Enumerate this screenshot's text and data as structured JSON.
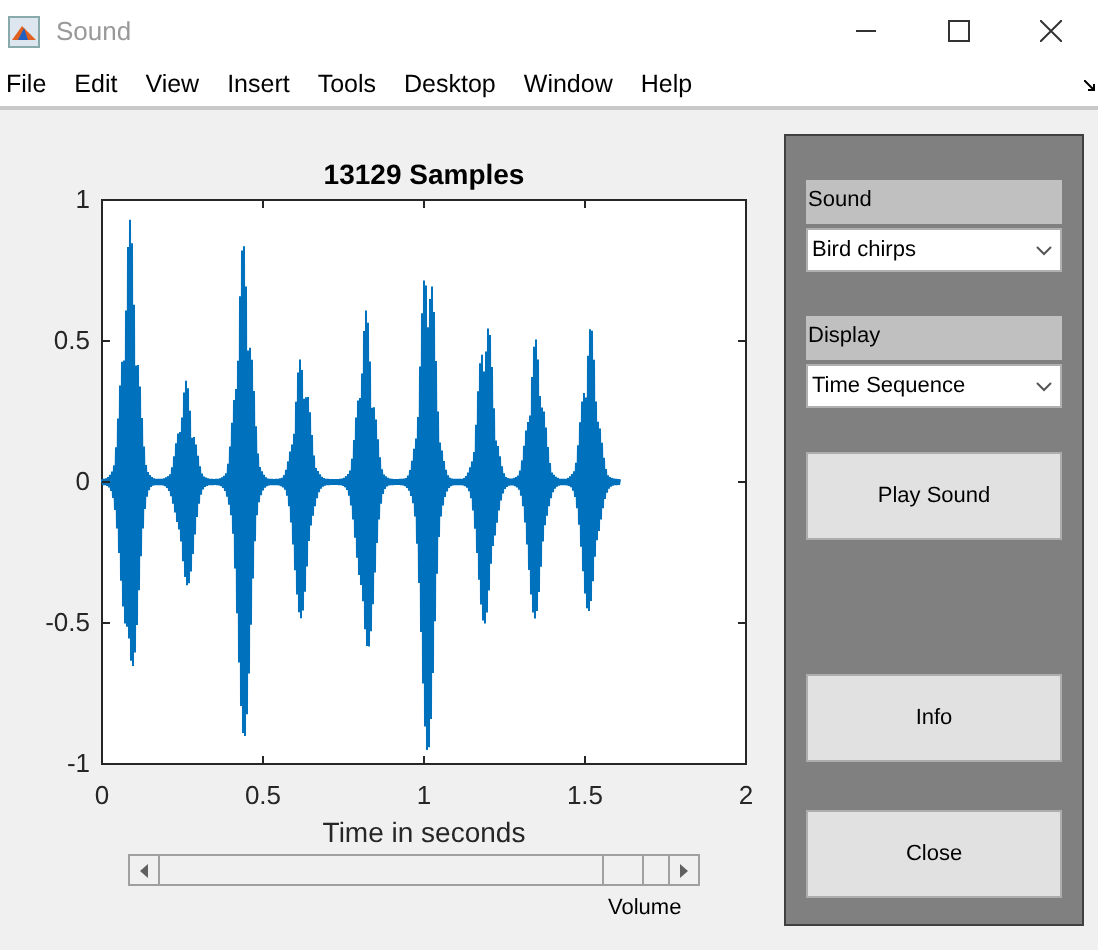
{
  "window": {
    "title": "Sound"
  },
  "menu": [
    "File",
    "Edit",
    "View",
    "Insert",
    "Tools",
    "Desktop",
    "Window",
    "Help"
  ],
  "plot": {
    "title": "13129 Samples",
    "xlabel": "Time in seconds",
    "xticks": [
      "0",
      "0.5",
      "1",
      "1.5",
      "2"
    ],
    "yticks": [
      "1",
      "0.5",
      "0",
      "-0.5",
      "-1"
    ]
  },
  "volume": {
    "label": "Volume",
    "level": 0.95
  },
  "panel": {
    "sound": {
      "label": "Sound",
      "value": "Bird chirps"
    },
    "display": {
      "label": "Display",
      "value": "Time Sequence"
    },
    "buttons": [
      "Play Sound",
      "Info",
      "Close"
    ]
  }
}
